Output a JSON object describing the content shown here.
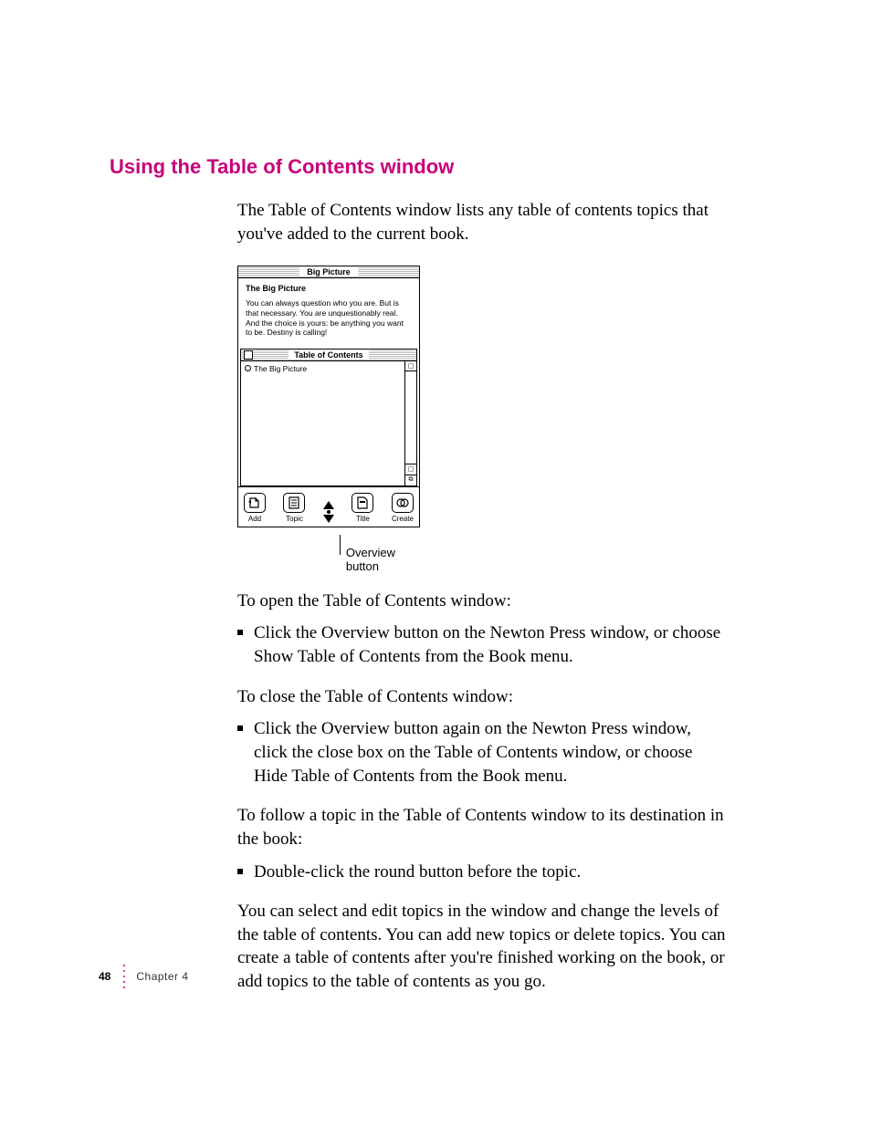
{
  "section_title": "Using the Table of Contents window",
  "intro": "The Table of Contents window lists any table of contents topics that you've added to the current book.",
  "screenshot": {
    "window_title": "Big Picture",
    "doc_heading": "The Big Picture",
    "doc_body": "You can always question who you are. But is that necessary. You are unquestionably real. And the choice is yours: be anything you want to be. Destiny is calling!",
    "toc_title": "Table of Contents",
    "toc_item": "The Big Picture",
    "buttons": {
      "add": "Add",
      "topic": "Topic",
      "title": "Title",
      "create": "Create"
    }
  },
  "callout_label": "Overview button",
  "paras": {
    "open": "To open the Table of Contents window:",
    "open_item": "Click the Overview button on the Newton Press window, or choose Show Table of Contents from the Book menu.",
    "close": "To close the Table of Contents window:",
    "close_item": "Click the Overview button again on the Newton Press window, click the close box on the Table of Contents window, or choose Hide Table of Contents from the Book menu.",
    "follow": "To follow a topic in the Table of Contents window to its destination in the book:",
    "follow_item": "Double-click the round button before the topic.",
    "conclude": "You can select and edit topics in the window and change the levels of the table of contents. You can add new topics or delete topics. You can create a table of contents after you're finished working on the book, or add topics to the table of contents as you go."
  },
  "footer": {
    "page_number": "48",
    "chapter": "Chapter 4"
  }
}
